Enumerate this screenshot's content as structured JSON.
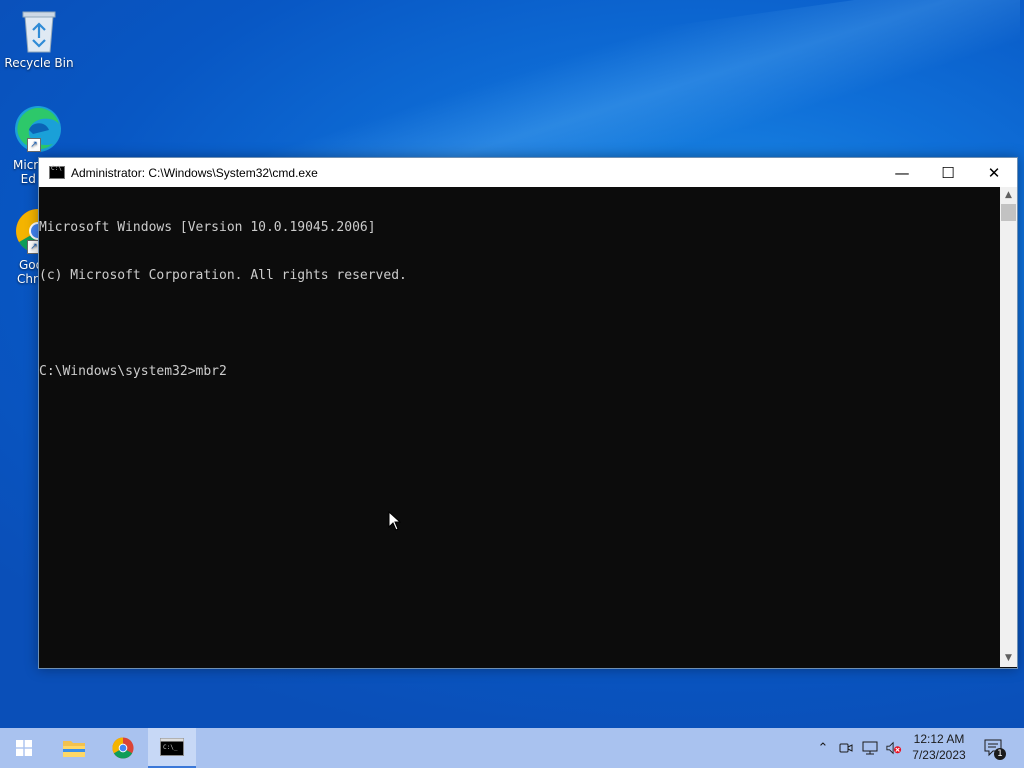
{
  "desktop": {
    "icons": [
      {
        "label": "Recycle Bin",
        "icon": "recycle-bin-icon"
      },
      {
        "label": "Micr\nEd",
        "icon": "edge-icon"
      },
      {
        "label": "Goo\nChro",
        "icon": "chrome-icon"
      }
    ]
  },
  "window": {
    "title": "Administrator: C:\\Windows\\System32\\cmd.exe",
    "controls": {
      "minimize": "—",
      "maximize": "☐",
      "close": "✕"
    },
    "console_lines": [
      "Microsoft Windows [Version 10.0.19045.2006]",
      "(c) Microsoft Corporation. All rights reserved.",
      "",
      "C:\\Windows\\system32>mbr2"
    ]
  },
  "taskbar": {
    "pinned": [
      {
        "name": "start-button",
        "icon": "windows-logo-icon"
      },
      {
        "name": "file-explorer-button",
        "icon": "folder-icon"
      },
      {
        "name": "chrome-button",
        "icon": "chrome-icon"
      },
      {
        "name": "cmd-button",
        "icon": "cmd-icon",
        "active": true
      }
    ],
    "tray": {
      "time": "12:12 AM",
      "date": "7/23/2023",
      "notification_count": "1"
    }
  },
  "colors": {
    "desktop": "#0a5fc8",
    "console_bg": "#0c0c0c",
    "console_fg": "#cccccc",
    "taskbar": "#a9c2ef"
  }
}
